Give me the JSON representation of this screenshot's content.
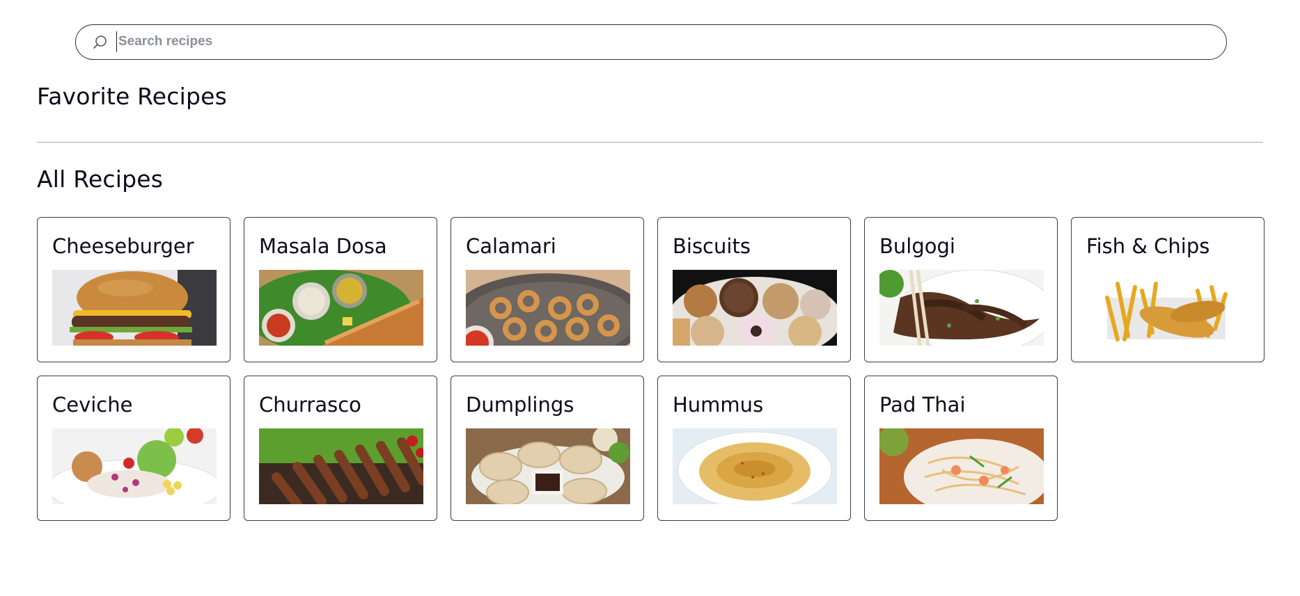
{
  "search": {
    "placeholder": "Search recipes",
    "value": ""
  },
  "sections": {
    "favorites_title": "Favorite Recipes",
    "all_title": "All Recipes"
  },
  "recipes": [
    {
      "name": "Cheeseburger",
      "image": "cheeseburger-photo"
    },
    {
      "name": "Masala Dosa",
      "image": "masala-dosa-photo"
    },
    {
      "name": "Calamari",
      "image": "calamari-photo"
    },
    {
      "name": "Biscuits",
      "image": "biscuits-photo"
    },
    {
      "name": "Bulgogi",
      "image": "bulgogi-photo"
    },
    {
      "name": "Fish & Chips",
      "image": "fish-and-chips-photo"
    },
    {
      "name": "Ceviche",
      "image": "ceviche-photo"
    },
    {
      "name": "Churrasco",
      "image": "churrasco-photo"
    },
    {
      "name": "Dumplings",
      "image": "dumplings-photo"
    },
    {
      "name": "Hummus",
      "image": "hummus-photo"
    },
    {
      "name": "Pad Thai",
      "image": "pad-thai-photo"
    }
  ]
}
